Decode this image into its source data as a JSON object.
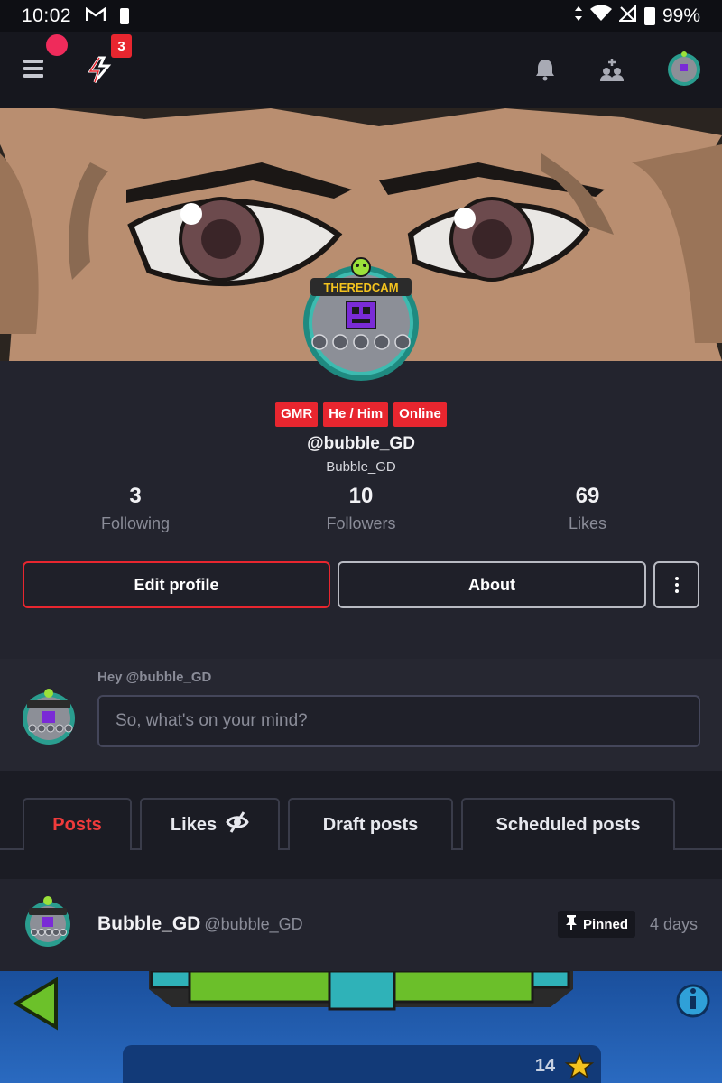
{
  "status_bar": {
    "time": "10:02",
    "battery": "99%"
  },
  "app_bar": {
    "notification_count": "3"
  },
  "profile": {
    "tags": [
      "GMR",
      "He / Him",
      "Online"
    ],
    "handle": "@bubble_GD",
    "display_name": "Bubble_GD",
    "stats": [
      {
        "value": "3",
        "label": "Following"
      },
      {
        "value": "10",
        "label": "Followers"
      },
      {
        "value": "69",
        "label": "Likes"
      }
    ],
    "edit_label": "Edit profile",
    "about_label": "About"
  },
  "composer": {
    "greeting": "Hey @bubble_GD",
    "placeholder": "So, what's on your mind?"
  },
  "tabs": [
    {
      "label": "Posts",
      "active": true
    },
    {
      "label": "Likes",
      "icon": "eye-off-icon"
    },
    {
      "label": "Draft posts"
    },
    {
      "label": "Scheduled posts"
    }
  ],
  "post": {
    "author": "Bubble_GD",
    "handle": "@bubble_GD",
    "pinned_label": "Pinned",
    "time": "4 days"
  },
  "avatar_text": "THEREDCAM",
  "game_preview": {
    "stars": "14"
  },
  "colors": {
    "accent": "#e8262f",
    "background": "#1b1c24",
    "surface": "#23242e"
  }
}
